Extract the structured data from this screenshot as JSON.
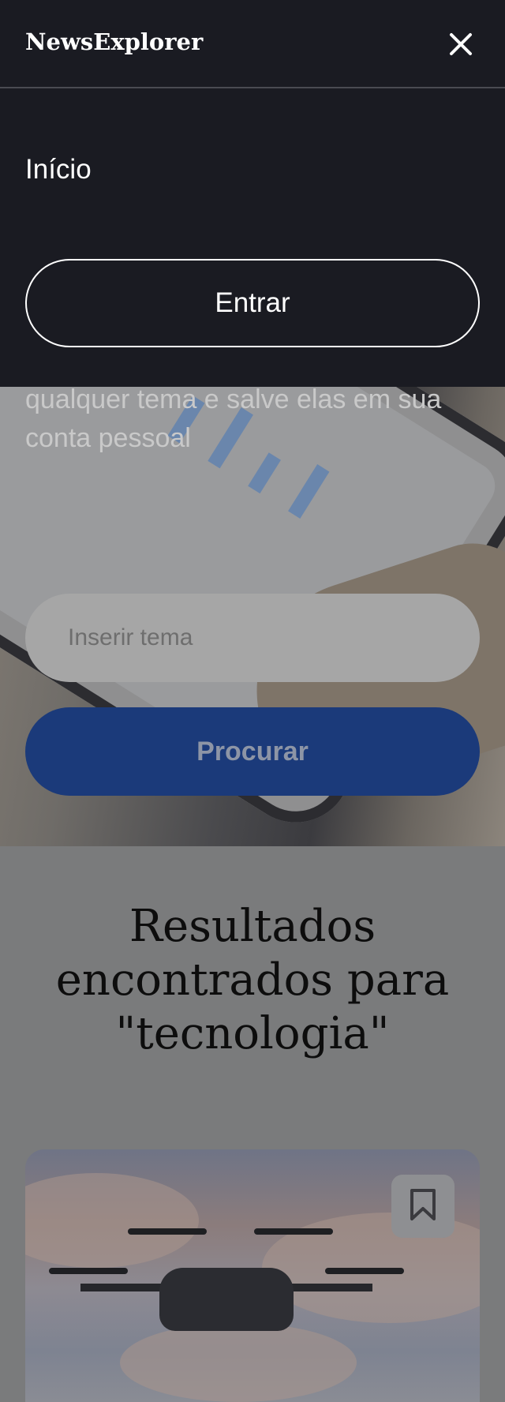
{
  "header": {
    "brand": "NewsExplorer",
    "close_icon": "close-icon"
  },
  "menu": {
    "home_label": "Início",
    "signin_label": "Entrar"
  },
  "hero": {
    "subtitle": "qualquer tema e salve elas em sua conta pessoal",
    "search_placeholder": "Inserir tema",
    "search_button": "Procurar"
  },
  "results": {
    "title": "Resultados encontrados para \"tecnologia\"",
    "cards": [
      {
        "bookmark_icon": "bookmark-icon"
      }
    ]
  },
  "colors": {
    "menu_bg": "#1a1b22",
    "search_button": "#1b3a7a",
    "results_bg": "#7a7b7c"
  }
}
